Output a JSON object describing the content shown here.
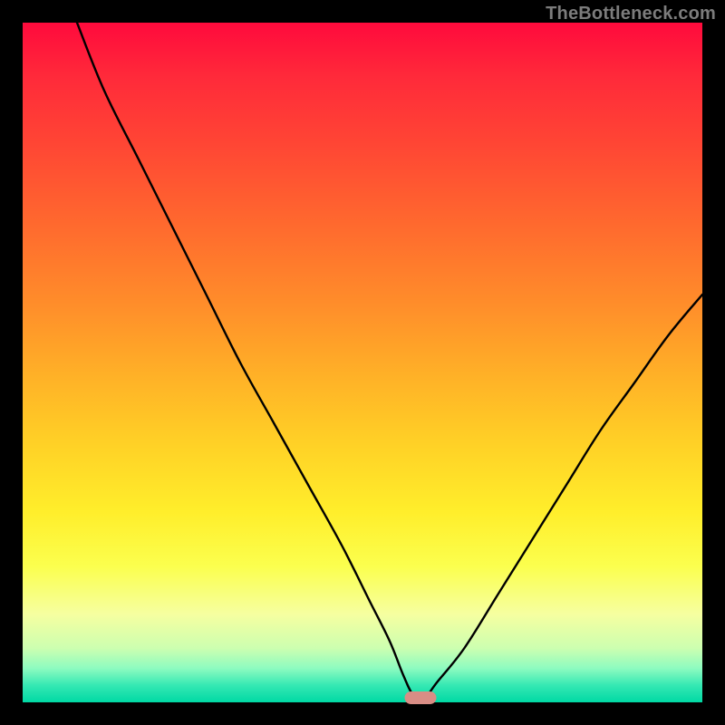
{
  "watermark": "TheBottleneck.com",
  "chart_data": {
    "type": "line",
    "title": "",
    "xlabel": "",
    "ylabel": "",
    "xlim": [
      0,
      100
    ],
    "ylim": [
      0,
      100
    ],
    "grid": false,
    "legend": false,
    "background": {
      "gradient_direction": "vertical_top_to_bottom",
      "comment": "Background heat gradient encodes bottleneck severity from high (top, red) to none (bottom, green).",
      "stops": [
        {
          "pct": 0,
          "color": "#ff0a3c"
        },
        {
          "pct": 8,
          "color": "#ff2a3a"
        },
        {
          "pct": 18,
          "color": "#ff4634"
        },
        {
          "pct": 30,
          "color": "#ff6a2e"
        },
        {
          "pct": 42,
          "color": "#ff8f2a"
        },
        {
          "pct": 52,
          "color": "#ffb127"
        },
        {
          "pct": 62,
          "color": "#ffd126"
        },
        {
          "pct": 72,
          "color": "#ffee2b"
        },
        {
          "pct": 80,
          "color": "#fbff4e"
        },
        {
          "pct": 87,
          "color": "#f6ffa0"
        },
        {
          "pct": 92,
          "color": "#cdffb0"
        },
        {
          "pct": 95,
          "color": "#8dfbc0"
        },
        {
          "pct": 97.5,
          "color": "#35e8b3"
        },
        {
          "pct": 100,
          "color": "#00d9a4"
        }
      ]
    },
    "series": [
      {
        "name": "bottleneck_curve",
        "color": "#000000",
        "comment": "Single V-shaped curve; y is bottleneck %, x is relative component balance. Values estimated visually.",
        "x": [
          8,
          12,
          17,
          22,
          27,
          32,
          37,
          42,
          47,
          51,
          54,
          56,
          57.5,
          59,
          61,
          65,
          70,
          75,
          80,
          85,
          90,
          95,
          100
        ],
        "y": [
          100,
          90,
          80,
          70,
          60,
          50,
          41,
          32,
          23,
          15,
          9,
          4,
          1,
          0.5,
          3,
          8,
          16,
          24,
          32,
          40,
          47,
          54,
          60
        ]
      }
    ],
    "minimum_marker": {
      "x": 58.5,
      "y": 0.7,
      "color": "#d98d85",
      "shape": "rounded_pill"
    }
  }
}
